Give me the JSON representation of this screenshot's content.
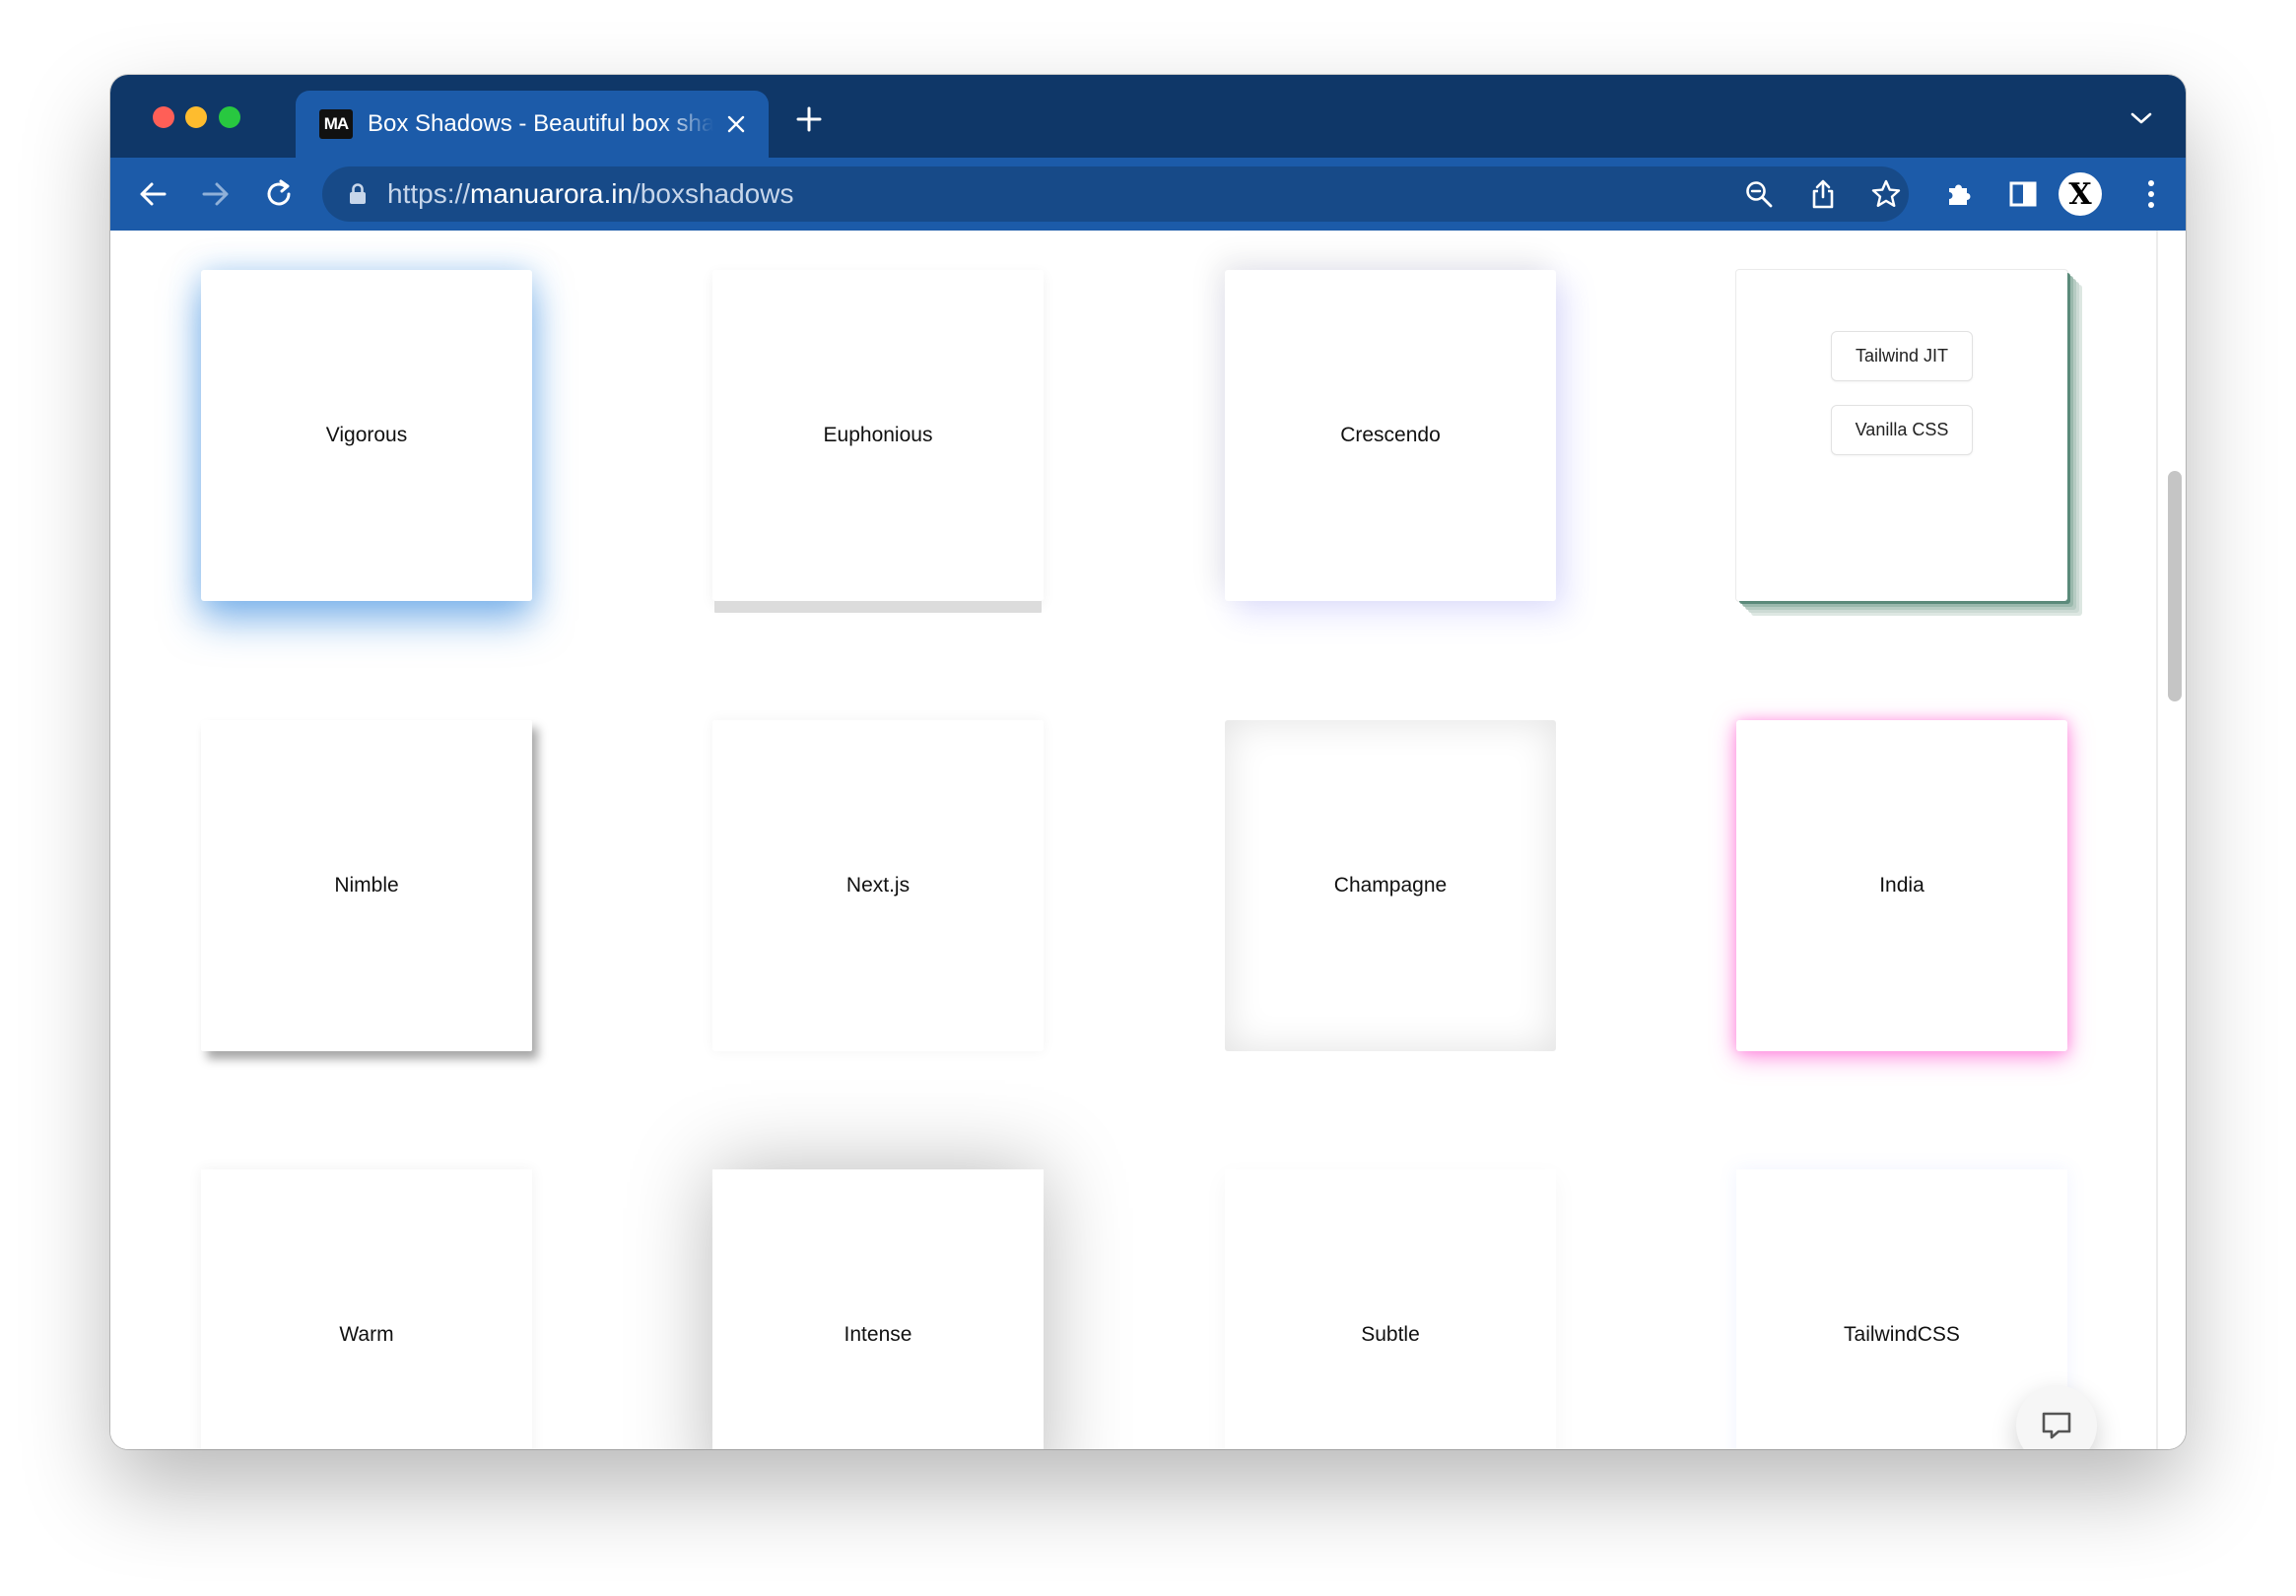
{
  "browser": {
    "tab": {
      "favicon_text": "MA",
      "title": "Box Shadows - Beautiful box shadows"
    },
    "address": {
      "scheme": "https://",
      "host": "manuarora.in",
      "path": "/boxshadows"
    },
    "icons": {
      "back": "back-arrow-icon",
      "forward": "forward-arrow-icon",
      "reload": "reload-icon",
      "lock": "lock-icon",
      "zoom": "zoom-icon",
      "share": "share-icon",
      "bookmark": "star-icon",
      "extensions": "puzzle-icon",
      "sidepanel": "side-panel-icon",
      "menu": "kebab-menu-icon"
    },
    "profile_avatar": "X"
  },
  "cards": [
    {
      "label": "Vigorous"
    },
    {
      "label": "Euphonious"
    },
    {
      "label": "Crescendo"
    },
    {
      "label": "",
      "options": [
        "Tailwind JIT",
        "Vanilla CSS"
      ]
    },
    {
      "label": "Nimble"
    },
    {
      "label": "Next.js"
    },
    {
      "label": "Champagne"
    },
    {
      "label": "India"
    },
    {
      "label": "Warm"
    },
    {
      "label": "Intense"
    },
    {
      "label": "Subtle"
    },
    {
      "label": "TailwindCSS"
    }
  ],
  "colors": {
    "titlebar": "#0f3768",
    "toolbar": "#1c5ba9",
    "omnibox": "#174a88",
    "vigorous_shadow": "#2882dc",
    "india_shadow": "#ff3cc8",
    "stack_shadow": "#5b8a7a"
  }
}
